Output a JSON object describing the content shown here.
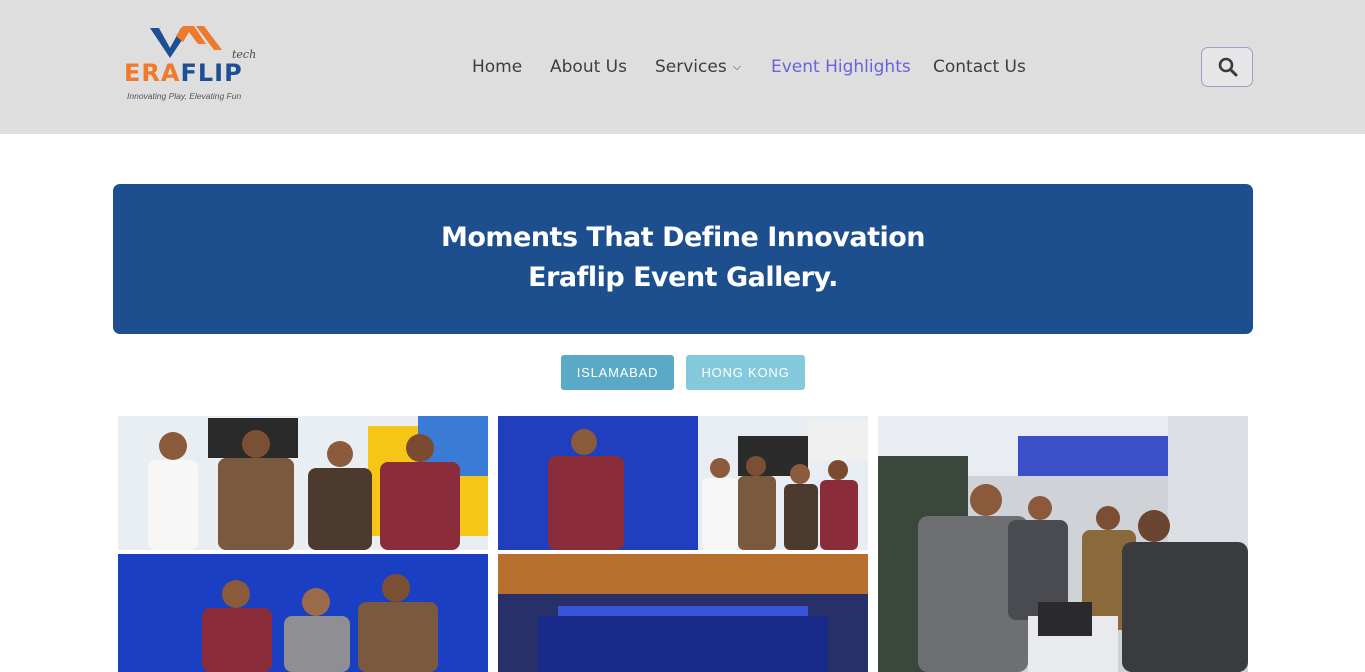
{
  "brand": {
    "name_part1": "ERA",
    "name_part2": "FLIP",
    "suffix": "tech",
    "tagline": "Innovating Play, Elevating Fun",
    "colors": {
      "orange": "#ef7a2b",
      "blue": "#1e4f95"
    }
  },
  "nav": {
    "items": [
      {
        "label": "Home"
      },
      {
        "label": "About Us"
      },
      {
        "label": "Services",
        "has_dropdown": true
      },
      {
        "label": "Event Highlights",
        "active": true
      },
      {
        "label": "Contact Us"
      }
    ],
    "active_color": "#6a63d9",
    "search_icon": "search-icon"
  },
  "banner": {
    "line1": "Moments That Define Innovation",
    "line2": "Eraflip Event Gallery.",
    "background": "#1d4f8e"
  },
  "filters": [
    {
      "label": "ISLAMABAD",
      "selected": true
    },
    {
      "label": "HONG KONG",
      "selected": false
    }
  ],
  "gallery": [
    {
      "name": "event-photo-team-booth"
    },
    {
      "name": "event-photo-conference-hall"
    },
    {
      "name": "event-photo-demo-laptop"
    }
  ]
}
